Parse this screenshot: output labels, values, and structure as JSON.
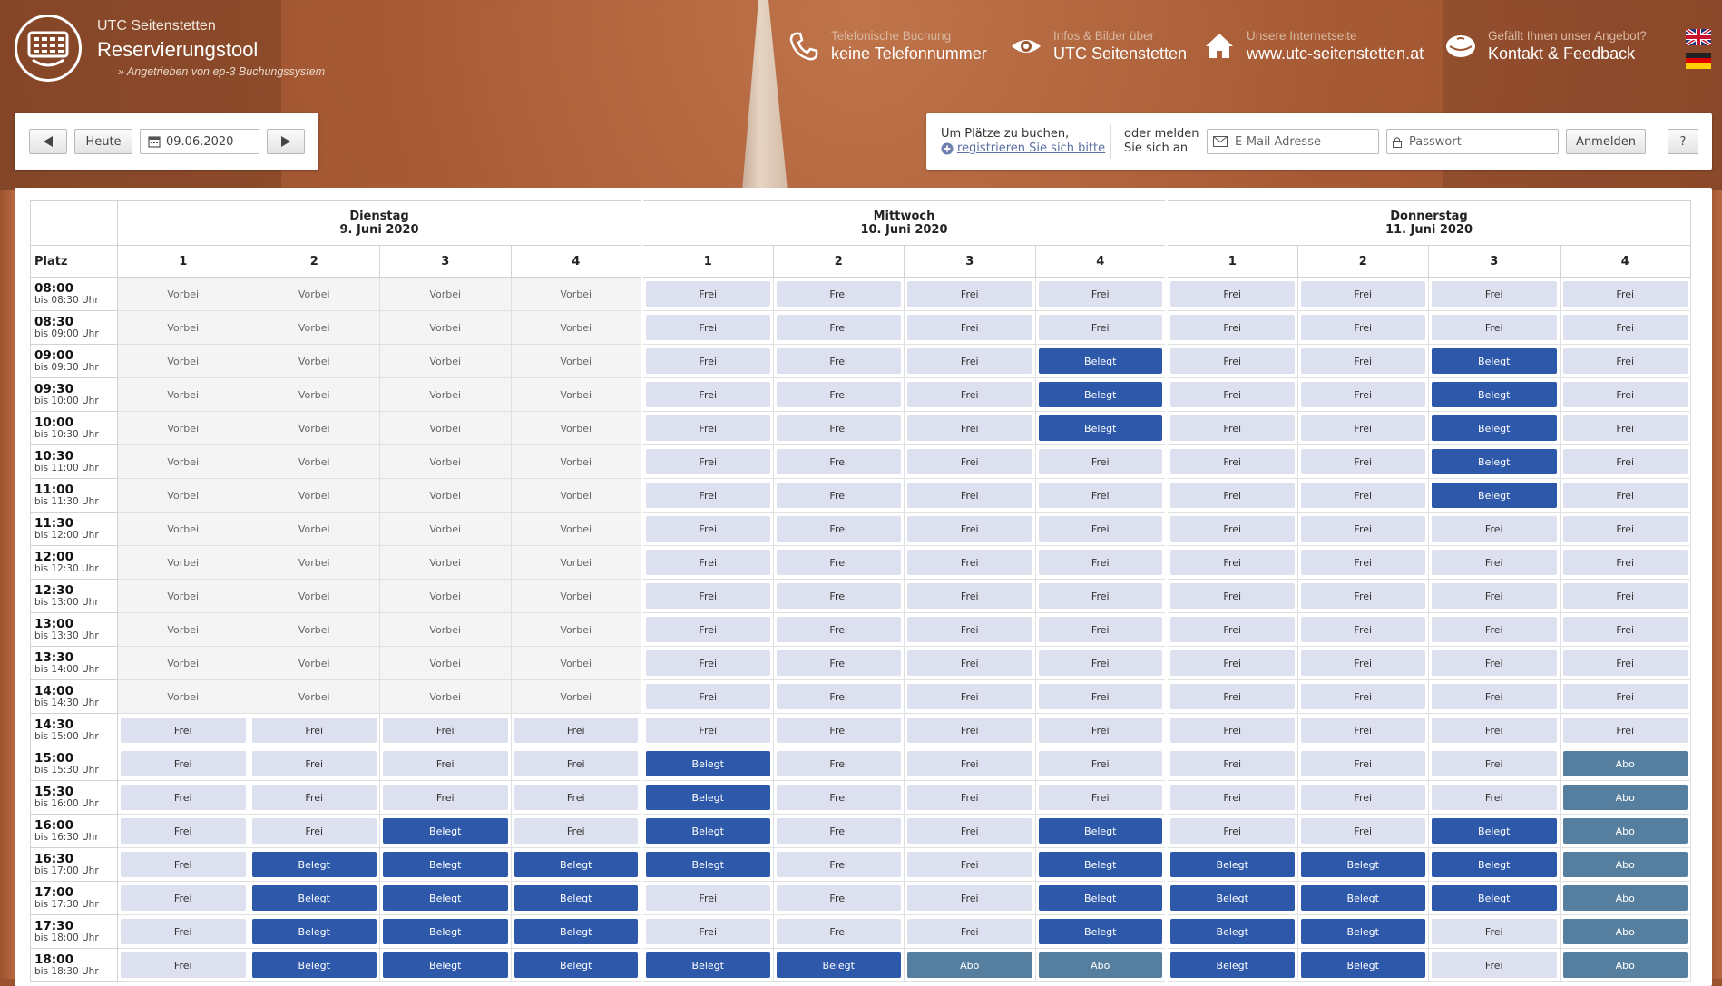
{
  "header": {
    "club": "UTC Seitenstetten",
    "tool": "Reservierungstool",
    "powered": "» Angetrieben von ep-3 Buchungssystem",
    "info": [
      {
        "icon": "phone-icon",
        "small": "Telefonische Buchung",
        "big": "keine Telefonnummer"
      },
      {
        "icon": "eye-icon",
        "small": "Infos & Bilder über",
        "big": "UTC Seitenstetten"
      },
      {
        "icon": "home-icon",
        "small": "Unsere Internetseite",
        "big": "www.utc-seitenstetten.at"
      },
      {
        "icon": "feedback-icon",
        "small": "Gefällt Ihnen unser Angebot?",
        "big": "Kontakt & Feedback"
      }
    ]
  },
  "nav": {
    "today": "Heute",
    "date": "09.06.2020"
  },
  "login": {
    "line1": "Um Plätze zu buchen,",
    "register": "registrieren Sie sich bitte",
    "or1": "oder melden",
    "or2": "Sie sich an",
    "email_placeholder": "E-Mail Adresse",
    "password_placeholder": "Passwort",
    "submit": "Anmelden",
    "help": "?"
  },
  "calendar": {
    "platz_label": "Platz",
    "days": [
      {
        "name": "Dienstag",
        "date": "9. Juni 2020"
      },
      {
        "name": "Mittwoch",
        "date": "10. Juni 2020"
      },
      {
        "name": "Donnerstag",
        "date": "11. Juni 2020"
      }
    ],
    "courts": [
      "1",
      "2",
      "3",
      "4"
    ],
    "status_labels": {
      "V": "Vorbei",
      "F": "Frei",
      "B": "Belegt",
      "A": "Abo"
    },
    "rows": [
      {
        "time": "08:00",
        "until": "bis 08:30 Uhr",
        "s": "VVVV FFFF FFFF"
      },
      {
        "time": "08:30",
        "until": "bis 09:00 Uhr",
        "s": "VVVV FFFF FFFF"
      },
      {
        "time": "09:00",
        "until": "bis 09:30 Uhr",
        "s": "VVVV FFFB FFBF"
      },
      {
        "time": "09:30",
        "until": "bis 10:00 Uhr",
        "s": "VVVV FFFB FFBF"
      },
      {
        "time": "10:00",
        "until": "bis 10:30 Uhr",
        "s": "VVVV FFFB FFBF"
      },
      {
        "time": "10:30",
        "until": "bis 11:00 Uhr",
        "s": "VVVV FFFF FFBF"
      },
      {
        "time": "11:00",
        "until": "bis 11:30 Uhr",
        "s": "VVVV FFFF FFBF"
      },
      {
        "time": "11:30",
        "until": "bis 12:00 Uhr",
        "s": "VVVV FFFF FFFF"
      },
      {
        "time": "12:00",
        "until": "bis 12:30 Uhr",
        "s": "VVVV FFFF FFFF"
      },
      {
        "time": "12:30",
        "until": "bis 13:00 Uhr",
        "s": "VVVV FFFF FFFF"
      },
      {
        "time": "13:00",
        "until": "bis 13:30 Uhr",
        "s": "VVVV FFFF FFFF"
      },
      {
        "time": "13:30",
        "until": "bis 14:00 Uhr",
        "s": "VVVV FFFF FFFF"
      },
      {
        "time": "14:00",
        "until": "bis 14:30 Uhr",
        "s": "VVVV FFFF FFFF"
      },
      {
        "time": "14:30",
        "until": "bis 15:00 Uhr",
        "s": "FFFF FFFF FFFF"
      },
      {
        "time": "15:00",
        "until": "bis 15:30 Uhr",
        "s": "FFFF BFFF FFFA"
      },
      {
        "time": "15:30",
        "until": "bis 16:00 Uhr",
        "s": "FFFF BFFF FFFA"
      },
      {
        "time": "16:00",
        "until": "bis 16:30 Uhr",
        "s": "FFBF BFFB FFBA"
      },
      {
        "time": "16:30",
        "until": "bis 17:00 Uhr",
        "s": "FBBB BFFB BBBA"
      },
      {
        "time": "17:00",
        "until": "bis 17:30 Uhr",
        "s": "FBBB FFFB BBBA"
      },
      {
        "time": "17:30",
        "until": "bis 18:00 Uhr",
        "s": "FBBB FFFB BBFA"
      },
      {
        "time": "18:00",
        "until": "bis 18:30 Uhr",
        "s": "FBBB BBAA BBFA"
      }
    ]
  },
  "colors": {
    "frei": "#dde1ef",
    "belegt": "#2e59ab",
    "abo": "#567f9f",
    "vorbei": "#f4f4f4"
  }
}
